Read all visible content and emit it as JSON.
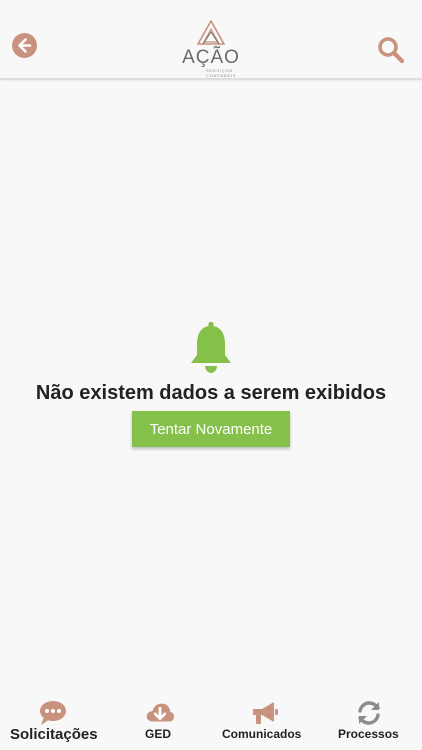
{
  "header": {
    "logo": {
      "word": "AÇÃO",
      "sub1": "SERVIÇOS",
      "sub2": "CONTÁBEIS"
    },
    "back_icon": "arrow-left-icon",
    "search_icon": "search-icon"
  },
  "empty_state": {
    "icon": "bell-icon",
    "message": "Não existem dados a serem exibidos",
    "retry_label": "Tentar Novamente"
  },
  "tabs": [
    {
      "label": "Solicitações",
      "icon": "chat-bubble-icon",
      "active": true
    },
    {
      "label": "GED",
      "icon": "cloud-download-icon",
      "active": false
    },
    {
      "label": "Comunicados",
      "icon": "megaphone-icon",
      "active": false
    },
    {
      "label": "Processos",
      "icon": "sync-icon",
      "active": false
    }
  ],
  "colors": {
    "brand": "#c9927e",
    "accent_green": "#84c04a",
    "inactive_icon": "#8c8c8c",
    "text": "#222222"
  }
}
